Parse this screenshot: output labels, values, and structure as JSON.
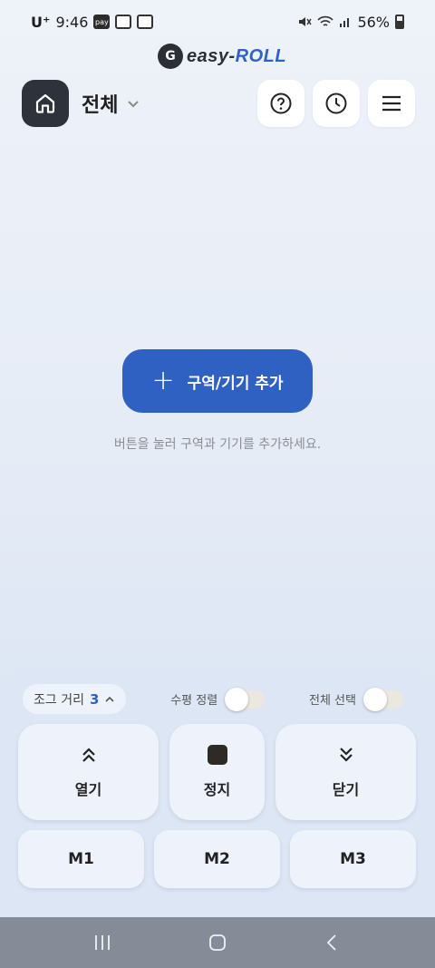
{
  "status_bar": {
    "carrier": "U⁺",
    "time": "9:46",
    "battery": "56%",
    "icons": [
      "pay-icon",
      "gallery-icon",
      "maps-icon",
      "mute-icon",
      "wifi-icon",
      "signal-icon",
      "battery-icon"
    ],
    "pay_label": "pay"
  },
  "logo": {
    "mark": "G",
    "text_main": "easy-",
    "text_accent": "ROLL"
  },
  "header": {
    "title": "전체",
    "icons": [
      "home-icon",
      "help-icon",
      "history-clock-icon",
      "menu-icon"
    ]
  },
  "main": {
    "add_button_label": "구역/기기 추가",
    "hint": "버튼을 눌러 구역과 기기를 추가하세요."
  },
  "panel": {
    "jog_label": "조그 거리",
    "jog_value": "3",
    "horizontal_align_label": "수평 정렬",
    "horizontal_align_on": false,
    "select_all_label": "전체 선택",
    "select_all_on": false,
    "open_label": "열기",
    "stop_label": "정지",
    "close_label": "닫기",
    "m1": "M1",
    "m2": "M2",
    "m3": "M3"
  },
  "colors": {
    "accent": "#2f61c2",
    "dark": "#2e323a",
    "panel": "#dde6f4",
    "navbar": "#858b97"
  }
}
